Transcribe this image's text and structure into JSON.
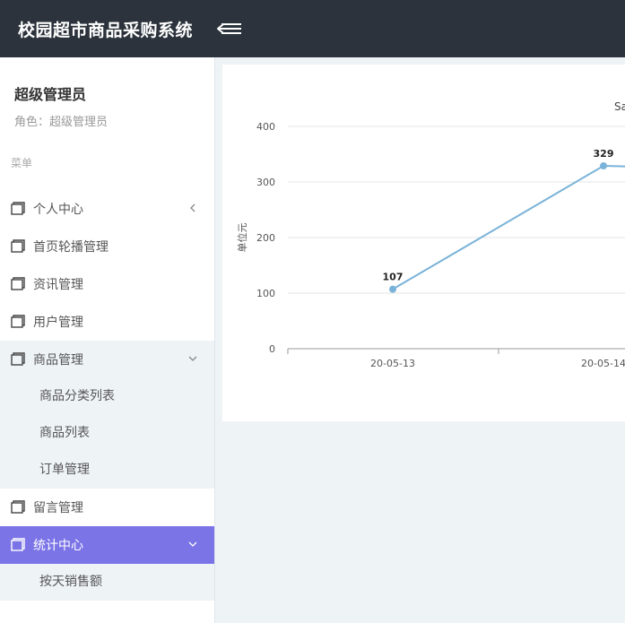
{
  "header": {
    "title": "校园超市商品采购系统"
  },
  "user": {
    "name": "超级管理员",
    "role": "角色：超级管理员"
  },
  "menu": {
    "caption": "菜单",
    "items": [
      {
        "label": "个人中心"
      },
      {
        "label": "首页轮播管理"
      },
      {
        "label": "资讯管理"
      },
      {
        "label": "用户管理"
      },
      {
        "label": "商品管理",
        "children": [
          "商品分类列表",
          "商品列表",
          "订单管理"
        ]
      },
      {
        "label": "留言管理"
      },
      {
        "label": "统计中心",
        "children": [
          "按天销售额"
        ]
      }
    ]
  },
  "colors": {
    "topbar": "#2c333c",
    "active": "#7b74e7",
    "line": "#7ab3d9"
  },
  "chart_data": {
    "type": "line",
    "title": "Sa",
    "ylabel": "单位元",
    "ylim": [
      0,
      400
    ],
    "yticks": [
      "0",
      "100",
      "200",
      "300",
      "400"
    ],
    "categories": [
      "20-05-13",
      "20-05-14"
    ],
    "values": [
      107,
      329
    ],
    "partial_next_value": 320,
    "grid": true
  }
}
